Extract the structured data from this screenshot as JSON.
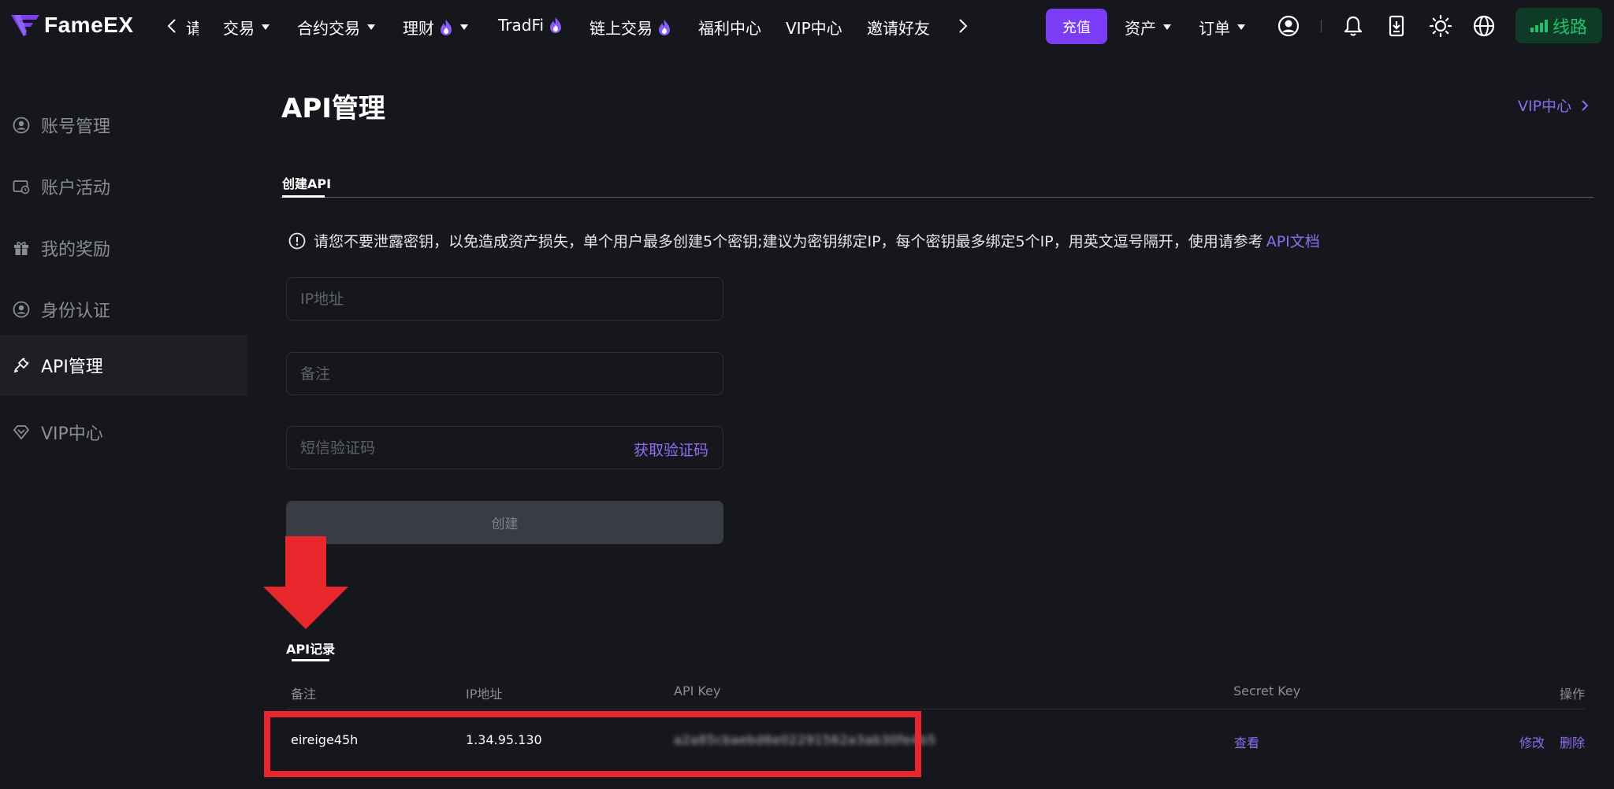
{
  "header": {
    "logo_text": "FameEX",
    "nav_clipped": "请",
    "nav": [
      {
        "label": "交易"
      },
      {
        "label": "合约交易"
      },
      {
        "label": "理财"
      },
      {
        "label": "TradFi"
      },
      {
        "label": "链上交易"
      },
      {
        "label": "福利中心"
      },
      {
        "label": "VIP中心"
      },
      {
        "label": "邀请好友"
      }
    ],
    "deposit_label": "充值",
    "assets_label": "资产",
    "orders_label": "订单",
    "route_label": "线路",
    "colors": {
      "accent": "#7b3cf6",
      "route_bg": "#0f3a28",
      "route_fg": "#21c26b"
    }
  },
  "sidebar": {
    "items": [
      {
        "label": "账号管理",
        "icon": "user-circle-icon"
      },
      {
        "label": "账户活动",
        "icon": "wallet-clock-icon"
      },
      {
        "label": "我的奖励",
        "icon": "gift-icon"
      },
      {
        "label": "身份认证",
        "icon": "id-user-icon"
      },
      {
        "label": "API管理",
        "icon": "api-plug-icon",
        "active": true
      },
      {
        "label": "VIP中心",
        "icon": "diamond-icon"
      }
    ]
  },
  "main": {
    "title": "API管理",
    "vip_link": "VIP中心",
    "tab_create": "创建API",
    "notice_text": "请您不要泄露密钥，以免造成资产损失，单个用户最多创建5个密钥;建议为密钥绑定IP，每个密钥最多绑定5个IP，用英文逗号隔开，使用请参考",
    "notice_link": "API文档",
    "form": {
      "ip_placeholder": "IP地址",
      "ip_value": "",
      "remark_placeholder": "备注",
      "remark_value": "",
      "sms_placeholder": "短信验证码",
      "sms_value": "",
      "get_code_label": "获取验证码",
      "create_label": "创建"
    },
    "records": {
      "title": "API记录",
      "headers": {
        "remark": "备注",
        "ip": "IP地址",
        "api_key": "API Key",
        "secret_key": "Secret Key",
        "actions": "操作"
      },
      "rows": [
        {
          "remark": "eireige45h",
          "ip": "1.34.95.130",
          "api_key": "a2a85cbaebd6e02291562a3ab30fe4b5",
          "secret_key_action": "查看",
          "edit": "修改",
          "delete": "删除"
        }
      ]
    },
    "annotation_color": "#e8272c"
  }
}
